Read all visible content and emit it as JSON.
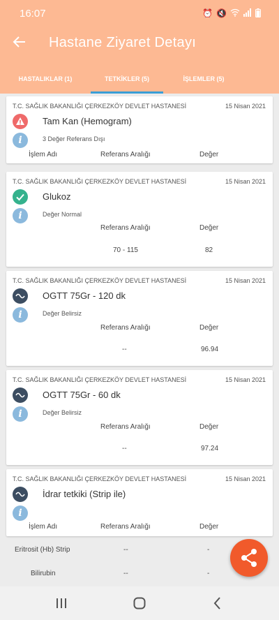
{
  "status_bar": {
    "time": "16:07",
    "icons": [
      "alarm-icon",
      "mute-icon",
      "wifi-icon",
      "signal-icon",
      "battery-icon"
    ]
  },
  "header": {
    "title": "Hastane Ziyaret Detayı",
    "tabs": [
      {
        "label": "HASTALIKLAR (1)",
        "active": false
      },
      {
        "label": "TETKİKLER (5)",
        "active": true
      },
      {
        "label": "İŞLEMLER (5)",
        "active": false
      }
    ]
  },
  "cards": [
    {
      "hospital": "T.C. SAĞLIK BAKANLIĞI ÇERKEZKÖY DEVLET HASTANESİ",
      "date": "15 Nisan 2021",
      "icon": "warning-icon",
      "name": "Tam Kan (Hemogram)",
      "status": "3 Değer Referans Dışı",
      "headers": {
        "islem": "İşlem Adı",
        "ref": "Referans Aralığı",
        "value": "Değer"
      }
    },
    {
      "hospital": "T.C. SAĞLIK BAKANLIĞI ÇERKEZKÖY DEVLET HASTANESİ",
      "date": "15 Nisan 2021",
      "icon": "check-icon",
      "name": "Glukoz",
      "status": "Değer Normal",
      "headers": {
        "ref": "Referans Aralığı",
        "value": "Değer"
      },
      "ref": "70 - 115",
      "value": "82"
    },
    {
      "hospital": "T.C. SAĞLIK BAKANLIĞI ÇERKEZKÖY DEVLET HASTANESİ",
      "date": "15 Nisan 2021",
      "icon": "wave-icon",
      "name": "OGTT 75Gr - 120 dk",
      "status": "Değer Belirsiz",
      "headers": {
        "ref": "Referans Aralığı",
        "value": "Değer"
      },
      "ref": "--",
      "value": "96.94"
    },
    {
      "hospital": "T.C. SAĞLIK BAKANLIĞI ÇERKEZKÖY DEVLET HASTANESİ",
      "date": "15 Nisan 2021",
      "icon": "wave-icon",
      "name": "OGTT 75Gr - 60 dk",
      "status": "Değer Belirsiz",
      "headers": {
        "ref": "Referans Aralığı",
        "value": "Değer"
      },
      "ref": "--",
      "value": "97.24"
    },
    {
      "hospital": "T.C. SAĞLIK BAKANLIĞI ÇERKEZKÖY DEVLET HASTANESİ",
      "date": "15 Nisan 2021",
      "icon": "wave-icon",
      "name": "İdrar tetkiki (Strip ile)",
      "headers": {
        "islem": "İşlem Adı",
        "ref": "Referans Aralığı",
        "value": "Değer"
      }
    }
  ],
  "urine_rows": [
    {
      "name": "Eritrosit (Hb) Strip",
      "ref": "--",
      "value": "-"
    },
    {
      "name": "Bilirubin",
      "ref": "--",
      "value": "-"
    }
  ],
  "fab": {
    "icon": "share-icon"
  },
  "navbar": {
    "icons": [
      "recents-icon",
      "home-icon",
      "back-icon"
    ]
  },
  "colors": {
    "header": "#fdb993",
    "tab_indicator": "#3a9ed6",
    "fab": "#f15a2b",
    "warning": "#ef6a6a",
    "ok": "#35b28d",
    "neutral": "#3c4d61",
    "info": "#8bb9dd"
  }
}
